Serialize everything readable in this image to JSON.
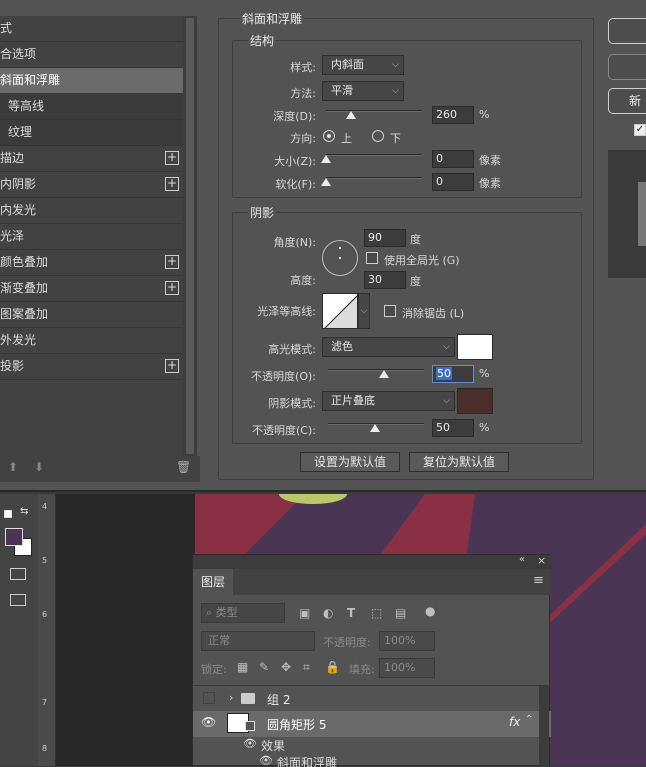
{
  "sidebar": {
    "items": [
      {
        "label": "式"
      },
      {
        "label": "合选项"
      },
      {
        "label": "斜面和浮雕"
      },
      {
        "label": "等高线"
      },
      {
        "label": "纹理"
      },
      {
        "label": "描边"
      },
      {
        "label": "内阴影"
      },
      {
        "label": "内发光"
      },
      {
        "label": "光泽"
      },
      {
        "label": "颜色叠加"
      },
      {
        "label": "渐变叠加"
      },
      {
        "label": "图案叠加"
      },
      {
        "label": "外发光"
      },
      {
        "label": "投影"
      }
    ],
    "plus": "+",
    "up_arrow": "⬆",
    "down_arrow": "⬇",
    "trash_icon": "🗑"
  },
  "bevel": {
    "group_title": "斜面和浮雕",
    "structure_title": "结构",
    "style_label": "样式:",
    "style_value": "内斜面",
    "technique_label": "方法:",
    "technique_value": "平滑",
    "depth_label": "深度(D):",
    "depth_value": "260",
    "depth_unit": "%",
    "direction_label": "方向:",
    "direction_up": "上",
    "direction_down": "下",
    "size_label": "大小(Z):",
    "size_value": "0",
    "size_unit": "像素",
    "soften_label": "软化(F):",
    "soften_value": "0",
    "soften_unit": "像素"
  },
  "shading": {
    "title": "阴影",
    "angle_label": "角度(N):",
    "angle_value": "90",
    "angle_unit": "度",
    "global_light_label": "使用全局光 (G)",
    "altitude_label": "高度:",
    "altitude_value": "30",
    "altitude_unit": "度",
    "gloss_contour_label": "光泽等高线:",
    "anti_alias_label": "消除锯齿 (L)",
    "highlight_mode_label": "高光模式:",
    "highlight_mode_value": "滤色",
    "highlight_color": "#ffffff",
    "highlight_opacity_label": "不透明度(O):",
    "highlight_opacity_value": "50",
    "highlight_opacity_unit": "%",
    "shadow_mode_label": "阴影模式:",
    "shadow_mode_value": "正片叠底",
    "shadow_color": "#4a2e2a",
    "shadow_opacity_label": "不透明度(C):",
    "shadow_opacity_value": "50",
    "shadow_opacity_unit": "%",
    "make_default": "设置为默认值",
    "reset_default": "复位为默认值"
  },
  "right_panel": {
    "new_style_button": "新"
  },
  "layers_panel": {
    "tab": "图层",
    "collapse_icon": "«",
    "close_icon": "×",
    "menu_icon": "≡",
    "filter_placeholder": "类型",
    "blend_mode": "正常",
    "opacity_label": "不透明度:",
    "opacity_value": "100%",
    "lock_label": "锁定:",
    "fill_label": "填充:",
    "fill_value": "100%",
    "layers": [
      {
        "name": "组 2"
      },
      {
        "name": "圆角矩形 5",
        "fx": "fx"
      },
      {
        "name": "效果"
      },
      {
        "name": "斜面和浮雕"
      }
    ]
  },
  "ruler": {
    "marks": [
      "4",
      "5",
      "6",
      "7",
      "8"
    ]
  },
  "colors": {
    "foreground": "#4a3554",
    "background": "#ffffff",
    "art_red": "#8a3045",
    "art_purple": "#4a3554",
    "art_green": "#b8c86a"
  }
}
